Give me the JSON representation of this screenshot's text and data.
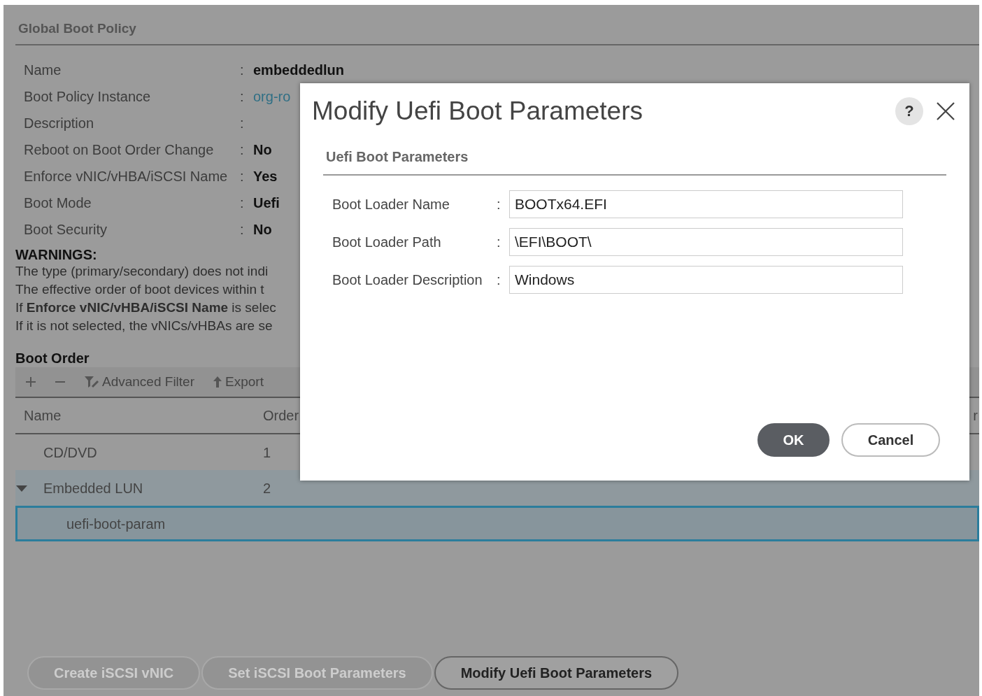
{
  "panel": {
    "title": "Global Boot Policy",
    "properties": [
      {
        "label": "Name",
        "colon": ":",
        "value": "embeddedlun",
        "kind": "bold"
      },
      {
        "label": "Boot Policy Instance",
        "colon": ":",
        "value": "org-ro",
        "kind": "link"
      },
      {
        "label": "Description",
        "colon": ":"
      },
      {
        "label": "Reboot on Boot Order Change",
        "colon": ":",
        "value": "No",
        "kind": "bold"
      },
      {
        "label": "Enforce vNIC/vHBA/iSCSI Name",
        "colon": ":",
        "value": "Yes",
        "kind": "bold"
      },
      {
        "label": "Boot Mode",
        "colon": ":",
        "value": "Uefi",
        "kind": "bold"
      },
      {
        "label": "Boot Security",
        "colon": ":",
        "value": "No",
        "kind": "bold"
      }
    ],
    "warnings": {
      "title": "WARNINGS:",
      "lines": [
        "The type (primary/secondary) does not indi",
        "The effective order of boot devices within t",
        "If **Enforce vNIC/vHBA/iSCSI Name** is selec",
        "If it is not selected, the vNICs/vHBAs are se"
      ]
    },
    "boot_order": {
      "title": "Boot Order",
      "toolbar": [
        {
          "kind": "add"
        },
        {
          "kind": "remove"
        },
        {
          "label": "Advanced Filter",
          "kind": "filter"
        },
        {
          "label": "Export",
          "kind": "export"
        }
      ],
      "columns": [
        "Name",
        "Order",
        "r"
      ],
      "rows": [
        {
          "name": "CD/DVD",
          "order": "1",
          "selected": false,
          "expanded": false,
          "kind": "leaf"
        },
        {
          "name": "Embedded LUN",
          "order": "2",
          "selected": false,
          "expanded": true,
          "kind": "parent"
        },
        {
          "name": "uefi-boot-param",
          "selected": true,
          "kind": "child"
        }
      ]
    },
    "buttons": [
      {
        "label": "Create iSCSI vNIC",
        "disabled": true
      },
      {
        "label": "Set iSCSI Boot Parameters",
        "disabled": true
      },
      {
        "label": "Modify Uefi Boot Parameters",
        "disabled": false
      }
    ]
  },
  "dialog": {
    "title": "Modify Uefi Boot Parameters",
    "help": "?",
    "section": "Uefi Boot Parameters",
    "fields": [
      {
        "label": "Boot Loader Name",
        "colon": ":",
        "value": "BOOTx64.EFI"
      },
      {
        "label": "Boot Loader Path",
        "colon": ":",
        "value": "\\EFI\\BOOT\\"
      },
      {
        "label": "Boot Loader Description",
        "colon": ":",
        "value": "Windows"
      }
    ],
    "buttons": [
      {
        "label": "OK",
        "kind": "primary"
      },
      {
        "label": "Cancel",
        "kind": "secondary"
      }
    ]
  }
}
